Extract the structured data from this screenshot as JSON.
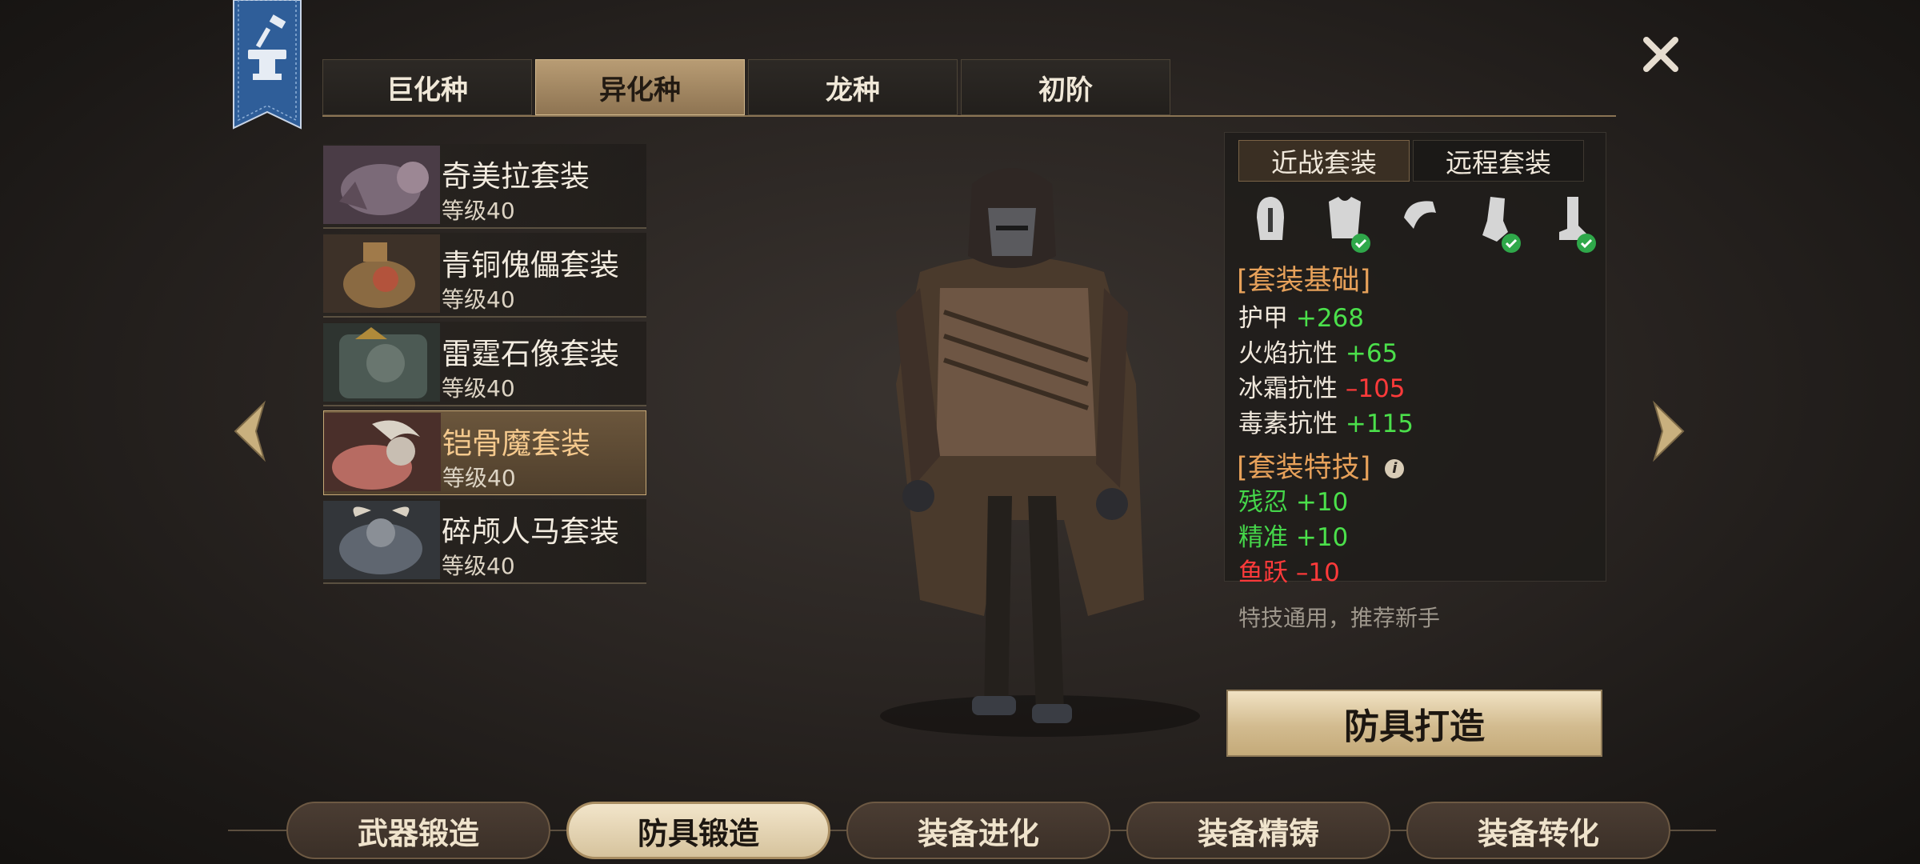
{
  "category_tabs": [
    {
      "label": "巨化种",
      "active": false
    },
    {
      "label": "异化种",
      "active": true
    },
    {
      "label": "龙种",
      "active": false
    },
    {
      "label": "初阶",
      "active": false
    }
  ],
  "sets": [
    {
      "name": "奇美拉套装",
      "level": "等级40",
      "active": false
    },
    {
      "name": "青铜傀儡套装",
      "level": "等级40",
      "active": false
    },
    {
      "name": "雷霆石像套装",
      "level": "等级40",
      "active": false
    },
    {
      "name": "铠骨魔套装",
      "level": "等级40",
      "active": true
    },
    {
      "name": "碎颅人马套装",
      "level": "等级40",
      "active": false
    }
  ],
  "set_type_tabs": [
    {
      "label": "近战套装",
      "active": true
    },
    {
      "label": "远程套装",
      "active": false
    }
  ],
  "armor_slots": [
    {
      "icon": "helmet-icon",
      "checked": false
    },
    {
      "icon": "chest-armor-icon",
      "checked": true
    },
    {
      "icon": "shoulder-armor-icon",
      "checked": false
    },
    {
      "icon": "gauntlet-icon",
      "checked": true
    },
    {
      "icon": "boots-icon",
      "checked": true
    }
  ],
  "base_section_title": "[套装基础]",
  "base_stats": [
    {
      "name": "护甲",
      "value": "+268",
      "sign": "pos"
    },
    {
      "name": "火焰抗性",
      "value": "+65",
      "sign": "pos"
    },
    {
      "name": "冰霜抗性",
      "value": "–105",
      "sign": "neg"
    },
    {
      "name": "毒素抗性",
      "value": "+115",
      "sign": "pos"
    }
  ],
  "skill_section_title": "[套装特技]",
  "skills": [
    {
      "name": "残忍",
      "value": "+10",
      "sign": "pos"
    },
    {
      "name": "精准",
      "value": "+10",
      "sign": "pos"
    },
    {
      "name": "鱼跃",
      "value": "–10",
      "sign": "neg"
    }
  ],
  "hint": "特技通用，推荐新手",
  "craft_button": "防具打造",
  "bottom_nav": [
    {
      "label": "武器锻造",
      "active": false
    },
    {
      "label": "防具锻造",
      "active": true
    },
    {
      "label": "装备进化",
      "active": false
    },
    {
      "label": "装备精铸",
      "active": false
    },
    {
      "label": "装备转化",
      "active": false
    }
  ],
  "colors": {
    "accent_gold": "#b89c74",
    "stat_positive": "#4be04b",
    "stat_negative": "#ff3a3a",
    "section_title": "#e7a15a",
    "banner_blue": "#3f6da8"
  }
}
